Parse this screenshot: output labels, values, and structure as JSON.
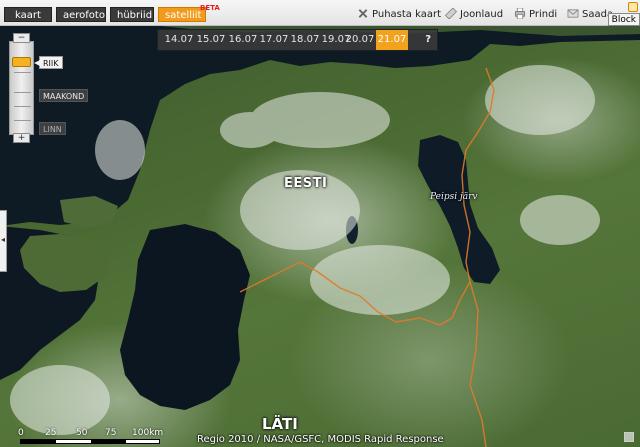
{
  "toolbar": {
    "map_types": [
      {
        "label": "kaart",
        "active": false
      },
      {
        "label": "aerofoto",
        "active": false
      },
      {
        "label": "hübriid",
        "active": false
      },
      {
        "label": "satelliit",
        "active": true
      }
    ],
    "beta_badge": "BETA",
    "tools": [
      {
        "label": "Puhasta kaart",
        "icon": "clear-x-icon"
      },
      {
        "label": "Joonlaud",
        "icon": "ruler-icon"
      },
      {
        "label": "Prindi",
        "icon": "printer-icon"
      },
      {
        "label": "Saada",
        "icon": "envelope-icon"
      }
    ],
    "block_label": "Block"
  },
  "dates": {
    "items": [
      "14.07",
      "15.07",
      "16.07",
      "17.07",
      "18.07",
      "19.07",
      "20.07",
      "21.07"
    ],
    "selected": "21.07",
    "help": "?"
  },
  "zoom": {
    "minus": "−",
    "plus": "+",
    "levels": [
      {
        "label": "RIIK",
        "active": true
      },
      {
        "label": "MAAKOND",
        "active": false
      },
      {
        "label": "LINN",
        "active": false
      }
    ]
  },
  "map": {
    "labels": {
      "country_main": "EESTI",
      "country_south": "LÄTI",
      "lake": "Peipsi järv"
    },
    "colors": {
      "border": "#e07a2a",
      "water": "#0c1620",
      "accent": "#f29a1e"
    }
  },
  "scale": {
    "ticks": [
      "0",
      "25",
      "50",
      "75",
      "100km"
    ]
  },
  "attribution": "Regio 2010 / NASA/GSFC, MODIS Rapid Response",
  "sidetab_glyph": "◂"
}
